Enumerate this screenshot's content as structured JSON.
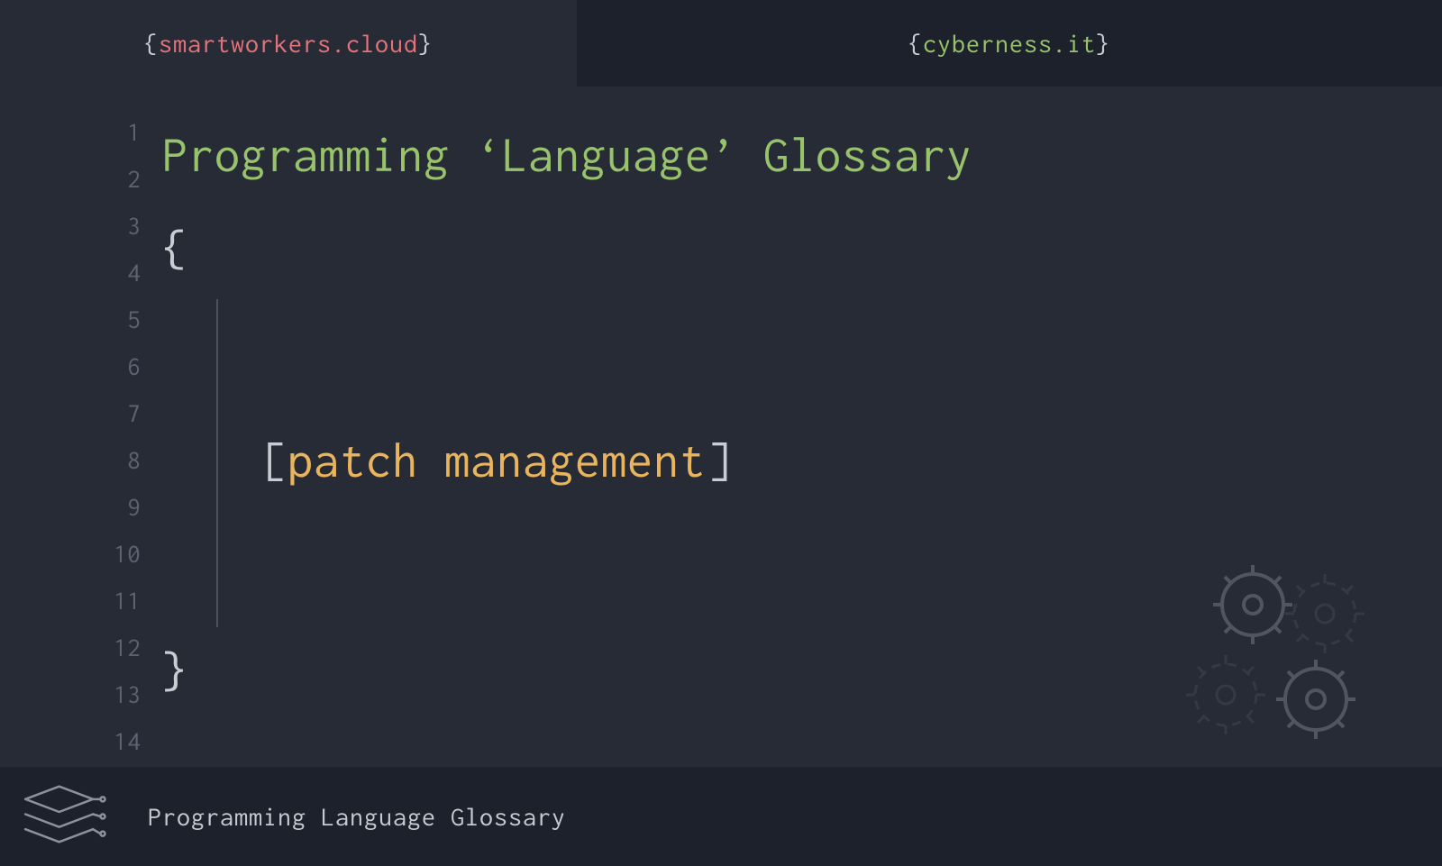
{
  "tabs": {
    "left": {
      "domain": "smartworkers.cloud"
    },
    "right": {
      "domain": "cyberness.it"
    }
  },
  "editor": {
    "title": "Programming ‘Language’ Glossary",
    "open_brace": "{",
    "close_brace": "}",
    "term": "patch management",
    "bracket_open": "[",
    "bracket_close": "]",
    "line_count": 14
  },
  "footer": {
    "title": "Programming Language Glossary"
  },
  "icons": {
    "gears": "gears-icon",
    "layers": "layers-icon"
  }
}
